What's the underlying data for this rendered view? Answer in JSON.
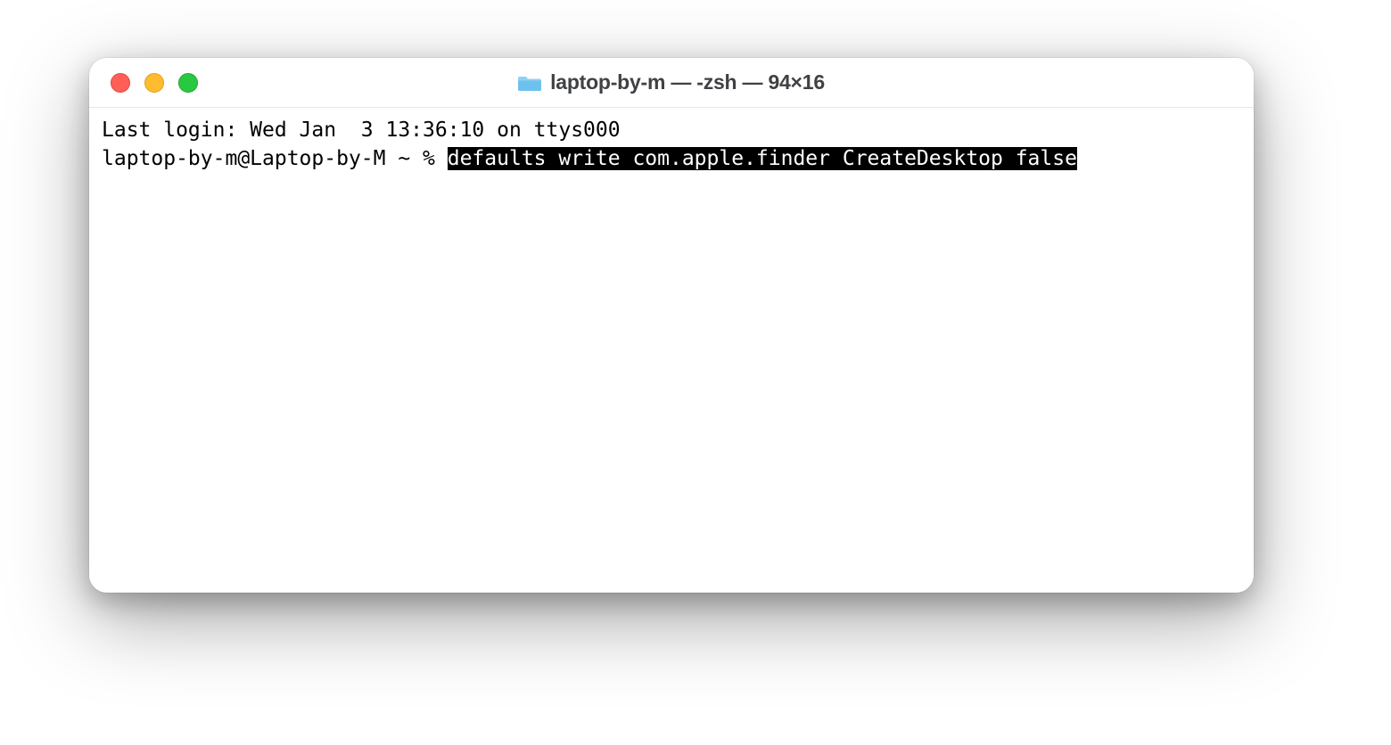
{
  "window": {
    "title": "laptop-by-m — -zsh — 94×16"
  },
  "terminal": {
    "last_login": "Last login: Wed Jan  3 13:36:10 on ttys000",
    "prompt": "laptop-by-m@Laptop-by-M ~ % ",
    "command": "defaults write com.apple.finder CreateDesktop false"
  }
}
